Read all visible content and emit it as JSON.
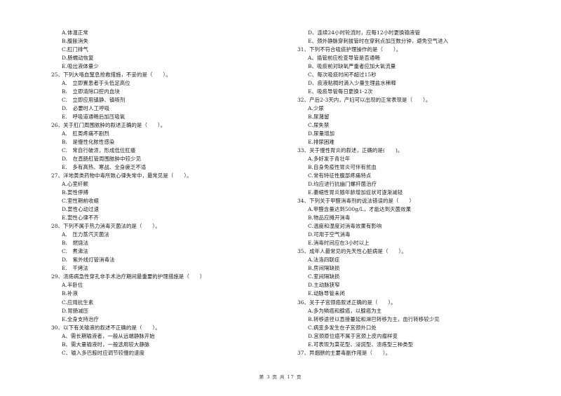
{
  "left_column": [
    {
      "type": "opt",
      "text": "A.体温正常"
    },
    {
      "type": "opt",
      "text": "B.腹胀消失"
    },
    {
      "type": "opt",
      "text": "C.肛门排气"
    },
    {
      "type": "opt",
      "text": "D.肠蠕动恢复"
    },
    {
      "type": "opt",
      "text": "E.吸出液体量少"
    },
    {
      "type": "q",
      "text": "25、下列大咯血窒息抢救措施，不妥的是（　　）。"
    },
    {
      "type": "opt",
      "text": "A.　立即置患者于头低足高位"
    },
    {
      "type": "opt",
      "text": "B.　立即清除口腔内血块"
    },
    {
      "type": "opt",
      "text": "C.　立即应用镇静、镇咳剂"
    },
    {
      "type": "opt",
      "text": "D.　必要时人工呼吸"
    },
    {
      "type": "opt",
      "text": "E.　呼吸道通畅后加压吸氧"
    },
    {
      "type": "q",
      "text": "26、关于肛门周围脓肿的叙述正确的是（　　）。"
    },
    {
      "type": "opt",
      "text": "A.　肛周疼痛不剧烈"
    },
    {
      "type": "opt",
      "text": "B.　是慢性化脓性感染"
    },
    {
      "type": "opt",
      "text": "C.　常自行破溃，形成低位肛瘘"
    },
    {
      "type": "opt",
      "text": "D.　在直肠肛管周围脓肿中较少见"
    },
    {
      "type": "opt",
      "text": "E.　多有高热、寒战、全身疲乏不适"
    },
    {
      "type": "q",
      "text": "27、洋地黄类药物中毒所致心律失常中，最常见是（　　）。"
    },
    {
      "type": "opt",
      "text": "A.心室纤颤"
    },
    {
      "type": "opt",
      "text": "B.窦性停搏"
    },
    {
      "type": "opt",
      "text": "C.室性期前收缩"
    },
    {
      "type": "opt",
      "text": "D.窦性心动过速"
    },
    {
      "type": "opt",
      "text": "E.窦性心律不齐"
    },
    {
      "type": "q",
      "text": "28、下列不属于热力消毒灭菌法的是（　　）。"
    },
    {
      "type": "opt",
      "text": "A.　压力蒸汽灭菌法"
    },
    {
      "type": "opt",
      "text": "B.　燃烧法"
    },
    {
      "type": "opt",
      "text": "C.　煮沸法"
    },
    {
      "type": "opt",
      "text": "D.　紫外线灯管消毒法"
    },
    {
      "type": "opt",
      "text": "E.　干烤法"
    },
    {
      "type": "q",
      "text": "29、溃疡病急性穿孔非手术治疗期间最重要的护理措施是（　　）"
    },
    {
      "type": "opt",
      "text": "A.半卧位"
    },
    {
      "type": "opt",
      "text": "B.补液"
    },
    {
      "type": "opt",
      "text": "C.应用抗生素"
    },
    {
      "type": "opt",
      "text": "D.胃肠减压"
    },
    {
      "type": "opt",
      "text": "E.全身支持治疗"
    },
    {
      "type": "q",
      "text": "30、以下有关输液的叙述不正确的是（　　）。"
    },
    {
      "type": "opt",
      "text": "A、需长期输液者，一般从远端静脉开始"
    },
    {
      "type": "opt",
      "text": "B、需大量输液时，一般选用较大静脉"
    },
    {
      "type": "opt",
      "text": "C、输入多巴胺时应调节较慢的速度"
    }
  ],
  "right_column": [
    {
      "type": "opt",
      "text": "D、连续24小时轮流时，应每12小时更换输液管"
    },
    {
      "type": "opt",
      "text": "E、颈外静脉穿刺拔管时在穿刺点加压数分钟，避免空气进入"
    },
    {
      "type": "q",
      "text": "31、下列不符合吸痰护理操作的是（　　）。"
    },
    {
      "type": "opt",
      "text": "A、插管前应检查导管是否通畅"
    },
    {
      "type": "opt",
      "text": "B、吸痰前对缺氧严重者应加大氧流量"
    },
    {
      "type": "opt",
      "text": "C、每次吸痰时间不超过15秒"
    },
    {
      "type": "opt",
      "text": "D、痰液粘稠时滴入少量生理盐水稀释"
    },
    {
      "type": "opt",
      "text": "E、吸痰导管每日更换1-2次"
    },
    {
      "type": "q",
      "text": "32、产后2-3天内，产妇可以出现的正常表现是（　　）。"
    },
    {
      "type": "opt",
      "text": "A.少尿"
    },
    {
      "type": "opt",
      "text": "B.尿潴留"
    },
    {
      "type": "opt",
      "text": "C.尿失禁"
    },
    {
      "type": "opt",
      "text": "D.尿量增加"
    },
    {
      "type": "opt",
      "text": "E.排尿困难"
    },
    {
      "type": "q",
      "text": "33、关于慢性胃炎的叙述，正确的是(　　)。"
    },
    {
      "type": "opt",
      "text": "A.多好发于青壮年"
    },
    {
      "type": "opt",
      "text": "B.自身免疫性胃炎可伴有贫血"
    },
    {
      "type": "opt",
      "text": "C.常有特征性腹部疼痛特点"
    },
    {
      "type": "opt",
      "text": "D.均应进行抗幽门螺杆菌治疗"
    },
    {
      "type": "opt",
      "text": "E.萎缩性胃炎随年龄增加症状可逐渐减轻"
    },
    {
      "type": "q",
      "text": "34、下列关于甲醛消毒剂的说法错误的是（　　）"
    },
    {
      "type": "opt",
      "text": "A.甲醛含量达到500g/L，才能达到灭菌效果"
    },
    {
      "type": "opt",
      "text": "B.物品应摊开消毒"
    },
    {
      "type": "opt",
      "text": "C.温度和湿度对消毒效果有影响"
    },
    {
      "type": "opt",
      "text": "D.可用于空气消毒"
    },
    {
      "type": "opt",
      "text": "E.消毒时间应在3小时以上"
    },
    {
      "type": "q",
      "text": "35、成年人最常见的先天性心脏病是（　　）。"
    },
    {
      "type": "opt",
      "text": "A.法洛四联症"
    },
    {
      "type": "opt",
      "text": "B.房间隔缺损"
    },
    {
      "type": "opt",
      "text": "C.室间隔缺损"
    },
    {
      "type": "opt",
      "text": "D.主动脉狭窄"
    },
    {
      "type": "opt",
      "text": "E.动脉导管未闭"
    },
    {
      "type": "q",
      "text": "36、关于子宫颈癌叙述正确的是（　　）。"
    },
    {
      "type": "opt",
      "text": "A.多为鳞癌和腺癌，以腺癌为主"
    },
    {
      "type": "opt",
      "text": "B.转移途径以直接蔓延和淋巴转移为主，血行转移较少见"
    },
    {
      "type": "opt",
      "text": "C.病变多发生在子宫颈外口处"
    },
    {
      "type": "opt",
      "text": "D.宫颈原位癌不属于宫颈上皮内瘤样变"
    },
    {
      "type": "opt",
      "text": "E.可表现为菜花型、浸润型、溃疡型三种类型"
    },
    {
      "type": "q",
      "text": "37、异烟肼的主要毒副作用是（　　）。"
    }
  ],
  "footer": {
    "page_label": "第 3 页 共 17 页"
  }
}
